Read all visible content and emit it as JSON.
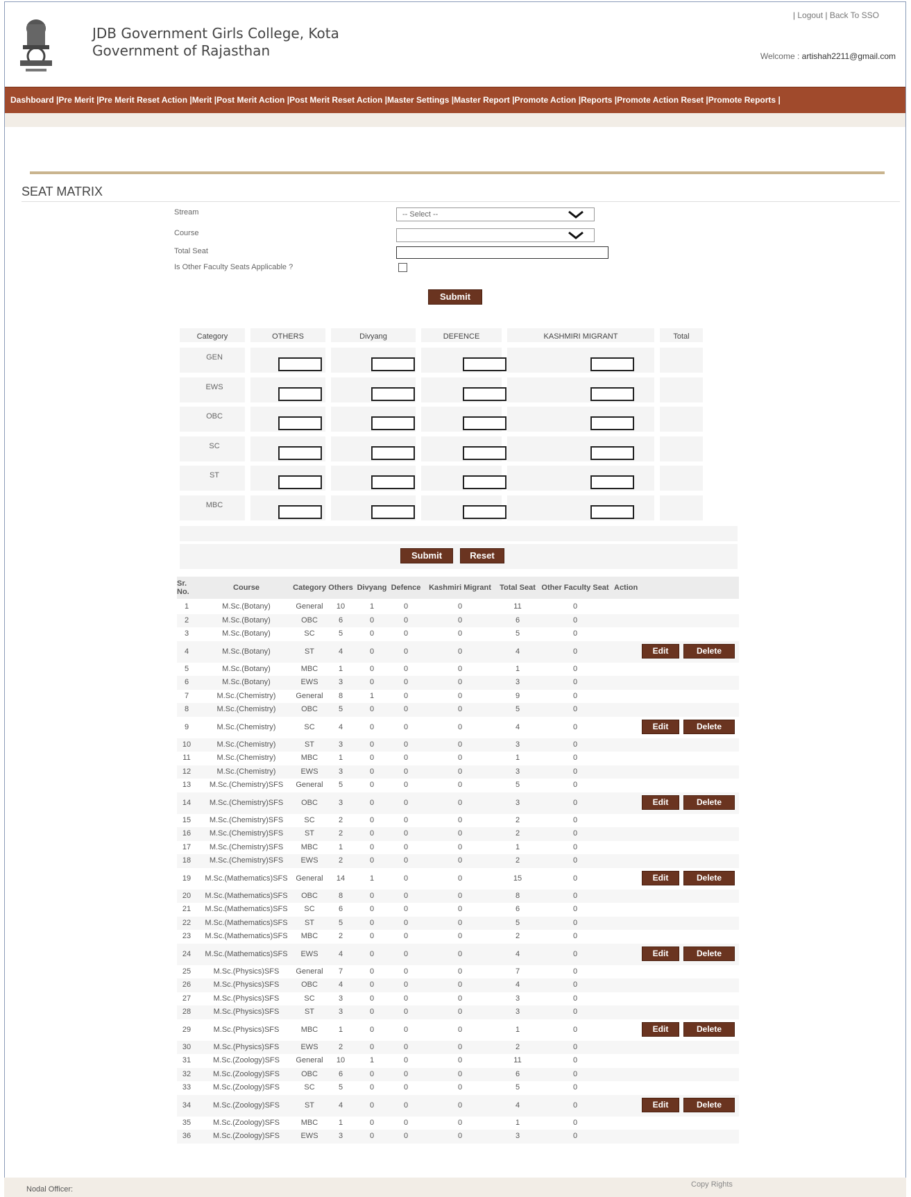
{
  "header": {
    "college_name": "JDB Government Girls College, Kota",
    "government": "Government of Rajasthan",
    "logout": "Logout",
    "back_to_sso": "Back To SSO",
    "welcome_label": "Welcome :",
    "welcome_user": "artishah2211@gmail.com"
  },
  "menu": [
    "Dashboard",
    "Pre Merit",
    "Pre Merit Reset Action",
    "Merit",
    "Post Merit Action",
    "Post Merit Reset Action",
    "Master Settings",
    "Master Report",
    "Promote Action",
    "Reports",
    "Promote Action Reset",
    "Promote Reports"
  ],
  "page_title": "SEAT MATRIX",
  "form": {
    "stream_label": "Stream",
    "stream_value": "-- Select --",
    "course_label": "Course",
    "course_value": "",
    "total_seat_label": "Total Seat",
    "total_seat_value": "",
    "other_faculty_label": "Is Other Faculty Seats Applicable ?",
    "submit": "Submit"
  },
  "category_table": {
    "headers": [
      "Category",
      "OTHERS",
      "Divyang",
      "DEFENCE",
      "KASHMIRI MIGRANT",
      "Total"
    ],
    "rows": [
      "GEN",
      "EWS",
      "OBC",
      "SC",
      "ST",
      "MBC"
    ],
    "submit": "Submit",
    "reset": "Reset"
  },
  "results_table": {
    "headers": [
      "Sr. No.",
      "Course",
      "Category",
      "Others",
      "Divyang",
      "Defence",
      "Kashmiri Migrant",
      "Total Seat",
      "Other Faculty Seat",
      "Action"
    ],
    "edit_label": "Edit",
    "delete_label": "Delete",
    "rows": [
      [
        "1",
        "M.Sc.(Botany)",
        "General",
        "10",
        "1",
        "0",
        "0",
        "11",
        "0"
      ],
      [
        "2",
        "M.Sc.(Botany)",
        "OBC",
        "6",
        "0",
        "0",
        "0",
        "6",
        "0"
      ],
      [
        "3",
        "M.Sc.(Botany)",
        "SC",
        "5",
        "0",
        "0",
        "0",
        "5",
        "0"
      ],
      [
        "4",
        "M.Sc.(Botany)",
        "ST",
        "4",
        "0",
        "0",
        "0",
        "4",
        "0"
      ],
      [
        "5",
        "M.Sc.(Botany)",
        "MBC",
        "1",
        "0",
        "0",
        "0",
        "1",
        "0"
      ],
      [
        "6",
        "M.Sc.(Botany)",
        "EWS",
        "3",
        "0",
        "0",
        "0",
        "3",
        "0"
      ],
      [
        "7",
        "M.Sc.(Chemistry)",
        "General",
        "8",
        "1",
        "0",
        "0",
        "9",
        "0"
      ],
      [
        "8",
        "M.Sc.(Chemistry)",
        "OBC",
        "5",
        "0",
        "0",
        "0",
        "5",
        "0"
      ],
      [
        "9",
        "M.Sc.(Chemistry)",
        "SC",
        "4",
        "0",
        "0",
        "0",
        "4",
        "0"
      ],
      [
        "10",
        "M.Sc.(Chemistry)",
        "ST",
        "3",
        "0",
        "0",
        "0",
        "3",
        "0"
      ],
      [
        "11",
        "M.Sc.(Chemistry)",
        "MBC",
        "1",
        "0",
        "0",
        "0",
        "1",
        "0"
      ],
      [
        "12",
        "M.Sc.(Chemistry)",
        "EWS",
        "3",
        "0",
        "0",
        "0",
        "3",
        "0"
      ],
      [
        "13",
        "M.Sc.(Chemistry)SFS",
        "General",
        "5",
        "0",
        "0",
        "0",
        "5",
        "0"
      ],
      [
        "14",
        "M.Sc.(Chemistry)SFS",
        "OBC",
        "3",
        "0",
        "0",
        "0",
        "3",
        "0"
      ],
      [
        "15",
        "M.Sc.(Chemistry)SFS",
        "SC",
        "2",
        "0",
        "0",
        "0",
        "2",
        "0"
      ],
      [
        "16",
        "M.Sc.(Chemistry)SFS",
        "ST",
        "2",
        "0",
        "0",
        "0",
        "2",
        "0"
      ],
      [
        "17",
        "M.Sc.(Chemistry)SFS",
        "MBC",
        "1",
        "0",
        "0",
        "0",
        "1",
        "0"
      ],
      [
        "18",
        "M.Sc.(Chemistry)SFS",
        "EWS",
        "2",
        "0",
        "0",
        "0",
        "2",
        "0"
      ],
      [
        "19",
        "M.Sc.(Mathematics)SFS",
        "General",
        "14",
        "1",
        "0",
        "0",
        "15",
        "0"
      ],
      [
        "20",
        "M.Sc.(Mathematics)SFS",
        "OBC",
        "8",
        "0",
        "0",
        "0",
        "8",
        "0"
      ],
      [
        "21",
        "M.Sc.(Mathematics)SFS",
        "SC",
        "6",
        "0",
        "0",
        "0",
        "6",
        "0"
      ],
      [
        "22",
        "M.Sc.(Mathematics)SFS",
        "ST",
        "5",
        "0",
        "0",
        "0",
        "5",
        "0"
      ],
      [
        "23",
        "M.Sc.(Mathematics)SFS",
        "MBC",
        "2",
        "0",
        "0",
        "0",
        "2",
        "0"
      ],
      [
        "24",
        "M.Sc.(Mathematics)SFS",
        "EWS",
        "4",
        "0",
        "0",
        "0",
        "4",
        "0"
      ],
      [
        "25",
        "M.Sc.(Physics)SFS",
        "General",
        "7",
        "0",
        "0",
        "0",
        "7",
        "0"
      ],
      [
        "26",
        "M.Sc.(Physics)SFS",
        "OBC",
        "4",
        "0",
        "0",
        "0",
        "4",
        "0"
      ],
      [
        "27",
        "M.Sc.(Physics)SFS",
        "SC",
        "3",
        "0",
        "0",
        "0",
        "3",
        "0"
      ],
      [
        "28",
        "M.Sc.(Physics)SFS",
        "ST",
        "3",
        "0",
        "0",
        "0",
        "3",
        "0"
      ],
      [
        "29",
        "M.Sc.(Physics)SFS",
        "MBC",
        "1",
        "0",
        "0",
        "0",
        "1",
        "0"
      ],
      [
        "30",
        "M.Sc.(Physics)SFS",
        "EWS",
        "2",
        "0",
        "0",
        "0",
        "2",
        "0"
      ],
      [
        "31",
        "M.Sc.(Zoology)SFS",
        "General",
        "10",
        "1",
        "0",
        "0",
        "11",
        "0"
      ],
      [
        "32",
        "M.Sc.(Zoology)SFS",
        "OBC",
        "6",
        "0",
        "0",
        "0",
        "6",
        "0"
      ],
      [
        "33",
        "M.Sc.(Zoology)SFS",
        "SC",
        "5",
        "0",
        "0",
        "0",
        "5",
        "0"
      ],
      [
        "34",
        "M.Sc.(Zoology)SFS",
        "ST",
        "4",
        "0",
        "0",
        "0",
        "4",
        "0"
      ],
      [
        "35",
        "M.Sc.(Zoology)SFS",
        "MBC",
        "1",
        "0",
        "0",
        "0",
        "1",
        "0"
      ],
      [
        "36",
        "M.Sc.(Zoology)SFS",
        "EWS",
        "3",
        "0",
        "0",
        "0",
        "3",
        "0"
      ]
    ]
  },
  "footer": {
    "nodal_officer": "Nodal Officer:",
    "copy_rights": "Copy Rights"
  },
  "colors": {
    "menu_bg": "#a04a2c",
    "button_bg": "#6a3420",
    "accent_line": "#c9b48e"
  }
}
